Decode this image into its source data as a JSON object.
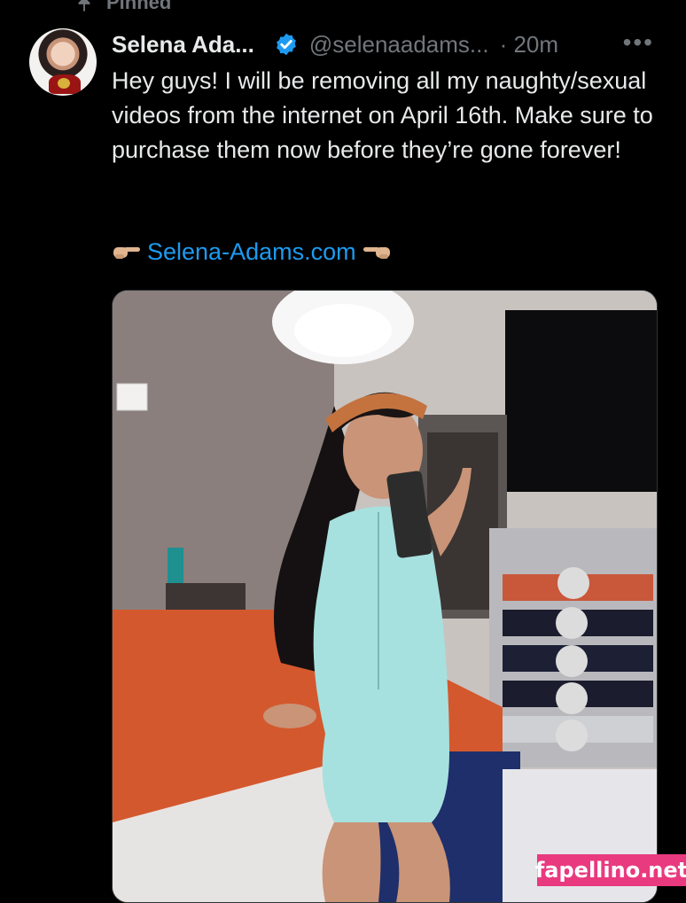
{
  "pinned_label": "Pinned",
  "author": {
    "display_name": "Selena Ada...",
    "handle": "@selenaadams...",
    "time": "· 20m",
    "verified": true
  },
  "more_label": "•••",
  "tweet": {
    "text": "Hey guys! I will be removing all my naughty/sexual videos from the internet on April 16th. Make sure to purchase them now before they’re gone forever!",
    "link": "Selena-Adams.com"
  },
  "watermark": "fapellino.net",
  "colors": {
    "background": "#000000",
    "text": "#e7e9ea",
    "muted": "#71767b",
    "link": "#1d9bf0",
    "verified": "#1d9bf0",
    "watermark_bg": "#e9397f"
  },
  "icons": {
    "pin": "pin-icon",
    "verified": "verified-badge-icon",
    "more": "more-icon",
    "left_hand": "pointing-right-hand-icon",
    "right_hand": "pointing-left-hand-icon"
  }
}
